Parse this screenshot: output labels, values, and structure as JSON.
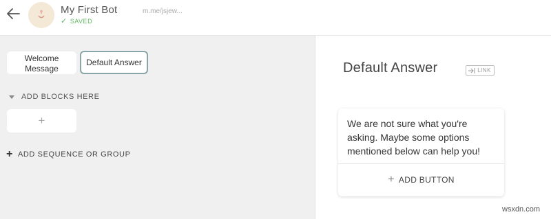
{
  "header": {
    "bot_name": "My First Bot",
    "status": "SAVED",
    "link": "m.me/jsjew..."
  },
  "sidebar": {
    "blocks": [
      "Welcome Message",
      "Default Answer"
    ],
    "add_blocks_label": "ADD BLOCKS HERE",
    "add_block_plus": "+",
    "add_sequence_label": "ADD SEQUENCE OR GROUP",
    "add_sequence_plus": "+"
  },
  "editor": {
    "title": "Default Answer",
    "link_label": "LINK",
    "message": "We are not sure what you're asking. Maybe some options mentioned below can help you!",
    "add_button_label": "ADD BUTTON",
    "add_button_plus": "+"
  },
  "watermark": "wsxdn.com",
  "colors": {
    "saved": "#5cb85c",
    "selected_border": "#8aa5a8",
    "panel_bg": "#f0f0f0"
  }
}
